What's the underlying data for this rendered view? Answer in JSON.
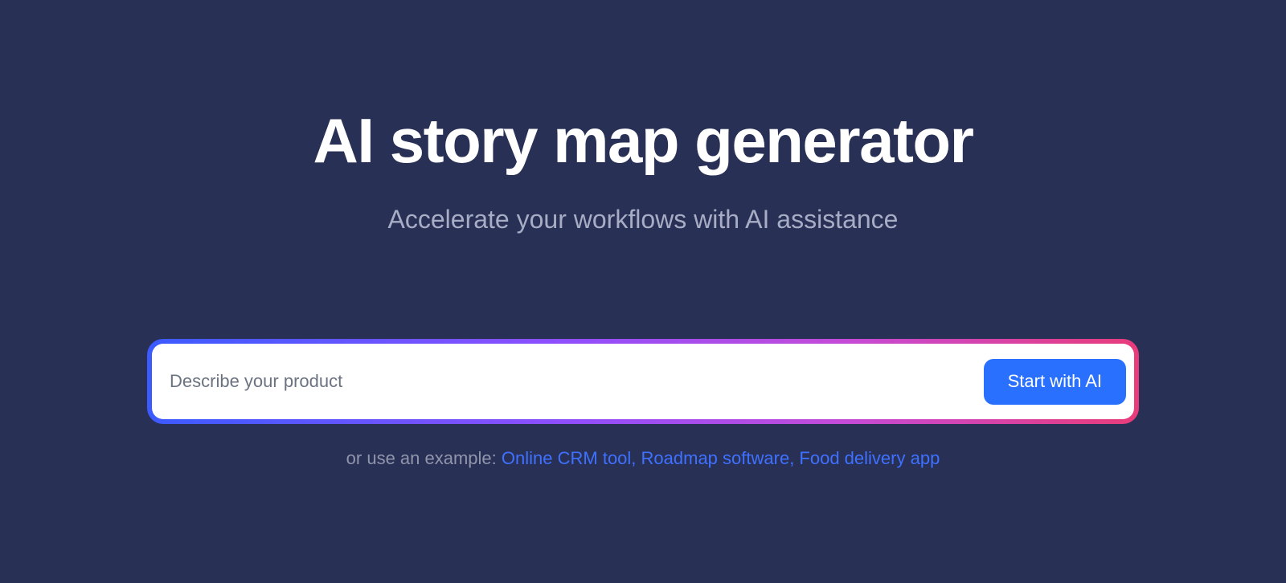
{
  "header": {
    "title": "AI story map generator",
    "subtitle": "Accelerate your workflows with AI assistance"
  },
  "prompt": {
    "placeholder": "Describe your product",
    "value": "",
    "button_label": "Start with AI"
  },
  "examples": {
    "lead": "or use an example: ",
    "sep": ", ",
    "items": [
      "Online CRM tool",
      "Roadmap software",
      "Food delivery app"
    ]
  }
}
